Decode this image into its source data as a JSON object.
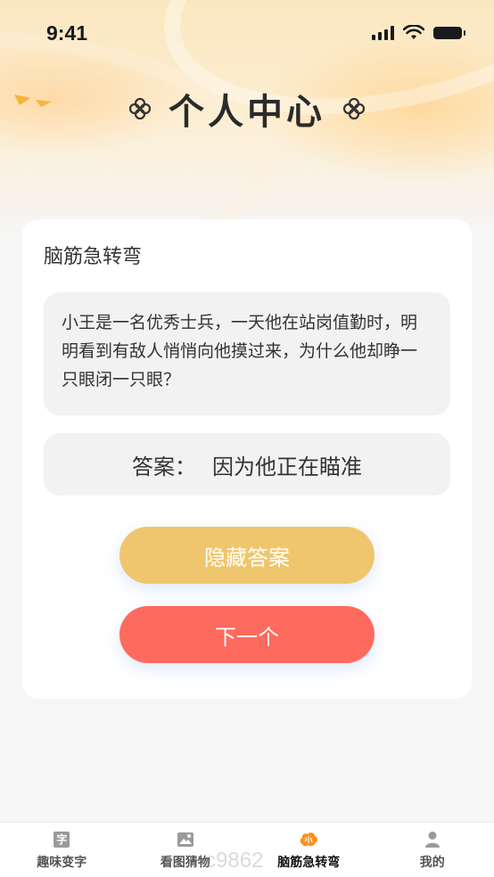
{
  "status_bar": {
    "time": "9:41"
  },
  "header": {
    "title": "个人中心"
  },
  "card": {
    "title": "脑筋急转弯",
    "question": "小王是一名优秀士兵，一天他在站岗值勤时，明明看到有敌人悄悄向他摸过来，为什么他却睁一只眼闭一只眼？",
    "answer_label": "答案：",
    "answer_text": "因为他正在瞄准",
    "hide_button_label": "隐藏答案",
    "next_button_label": "下一个"
  },
  "tabbar": {
    "items": [
      {
        "label": "趣味变字",
        "icon": "char-icon",
        "icon_glyph": "字",
        "active": false
      },
      {
        "label": "看图猜物",
        "icon": "picture-icon",
        "active": false
      },
      {
        "label": "脑筋急转弯",
        "icon": "brain-icon",
        "active": true
      },
      {
        "label": "我的",
        "icon": "user-icon",
        "active": false
      }
    ]
  },
  "watermark": "c9862",
  "colors": {
    "hide_button": "#efc66e",
    "next_button": "#fe6a5e",
    "brain_icon": "#f7931e"
  }
}
